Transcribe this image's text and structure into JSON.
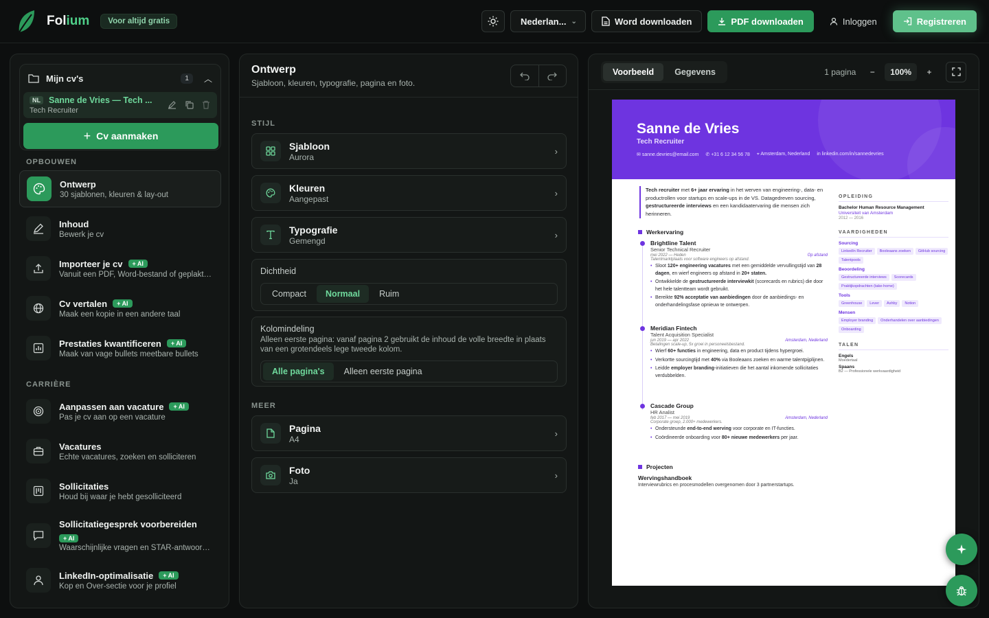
{
  "app": {
    "brand_first": "Fol",
    "brand_accent": "ium",
    "free_badge": "Voor altijd gratis"
  },
  "toolbar": {
    "language": "Nederlan...",
    "word_download": "Word downloaden",
    "pdf_download": "PDF downloaden",
    "login": "Inloggen",
    "register": "Registreren"
  },
  "cvs": {
    "title": "Mijn cv's",
    "count": "1",
    "item": {
      "lang": "NL",
      "name": "Sanne de Vries — Tech ...",
      "role": "Tech Recruiter"
    },
    "create": "Cv aanmaken"
  },
  "sidebar": {
    "section_build": "OPBOUWEN",
    "section_career": "CARRIÈRE",
    "ai_badge": "+ AI",
    "items": [
      {
        "title": "Ontwerp",
        "sub": "30 sjablonen, kleuren & lay-out"
      },
      {
        "title": "Inhoud",
        "sub": "Bewerk je cv"
      },
      {
        "title": "Importeer je cv",
        "sub": "Vanuit een PDF, Word-bestand of geplakte tekst"
      },
      {
        "title": "Cv vertalen",
        "sub": "Maak een kopie in een andere taal"
      },
      {
        "title": "Prestaties kwantificeren",
        "sub": "Maak van vage bullets meetbare bullets"
      },
      {
        "title": "Aanpassen aan vacature",
        "sub": "Pas je cv aan op een vacature"
      },
      {
        "title": "Vacatures",
        "sub": "Echte vacatures, zoeken en solliciteren"
      },
      {
        "title": "Sollicitaties",
        "sub": "Houd bij waar je hebt gesolliciteerd"
      },
      {
        "title": "Sollicitatiegesprek voorbereiden",
        "sub": "Waarschijnlijke vragen en STAR-antwoorden"
      },
      {
        "title": "LinkedIn-optimalisatie",
        "sub": "Kop en Over-sectie voor je profiel"
      }
    ]
  },
  "design": {
    "title": "Ontwerp",
    "subtitle": "Sjabloon, kleuren, typografie, pagina en foto.",
    "section_style": "STIJL",
    "section_more": "MEER",
    "options": [
      {
        "title": "Sjabloon",
        "value": "Aurora"
      },
      {
        "title": "Kleuren",
        "value": "Aangepast"
      },
      {
        "title": "Typografie",
        "value": "Gemengd"
      },
      {
        "title": "Pagina",
        "value": "A4"
      },
      {
        "title": "Foto",
        "value": "Ja"
      }
    ],
    "density": {
      "label": "Dichtheid",
      "options": [
        "Compact",
        "Normaal",
        "Ruim"
      ],
      "selected": "Normaal"
    },
    "columns": {
      "label": "Kolomindeling",
      "desc": "Alleen eerste pagina: vanaf pagina 2 gebruikt de inhoud de volle breedte in plaats van een grotendeels lege tweede kolom.",
      "options": [
        "Alle pagina's",
        "Alleen eerste pagina"
      ],
      "selected": "Alle pagina's"
    }
  },
  "preview": {
    "tabs": [
      "Voorbeeld",
      "Gegevens"
    ],
    "pages": "1 pagina",
    "zoom": "100%",
    "resume": {
      "name": "Sanne de Vries",
      "role": "Tech Recruiter",
      "email": "sanne.devries@email.com",
      "phone": "+31 6 12 34 56 78",
      "location": "Amsterdam, Nederland",
      "linkedin": "linkedin.com/in/sannedevries",
      "summary_html": "<b>Tech recruiter</b> met <b>6+ jaar ervaring</b> in het werven van engineering-, data- en productrollen voor startups en scale-ups in de VS. Datagedreven sourcing, <b>gestructureerde interviews</b> en een kandidaatervaring die mensen zich herinneren.",
      "experience_title": "Werkervaring",
      "jobs": [
        {
          "company": "Brightline Talent",
          "role": "Senior Technical Recruiter",
          "dates": "mei 2022 — Heden",
          "location": "Op afstand",
          "note": "Talentmarktplaats voor software engineers op afstand.",
          "bullets": [
            "Sloot <b>120+ engineering vacatures</b> met een gemiddelde vervullingstijd van <b>28 dagen</b>, en wierf engineers op afstand in <b>20+ staten.</b>",
            "Ontwikkelde de <b>gestructureerde interviewkit</b> (scorecards en rubrics) die door het hele talentteam wordt gebruikt.",
            "Bereikte <b>92% acceptatie van aanbiedingen</b> door de aanbiedings- en onderhandelingsfase opnieuw te ontwerpen."
          ]
        },
        {
          "company": "Meridian Fintech",
          "role": "Talent Acquisition Specialist",
          "dates": "jun 2019 — apr 2022",
          "location": "Amsterdam, Nederland",
          "note": "Betalingen scale-up, 5x groei in personeelsbestand.",
          "bullets": [
            "Wierf <b>60+ functies</b> in engineering, data en product tijdens hypergroei.",
            "Verkortte sourcingtijd met <b>40%</b> via Booleaans zoeken en warme talentpijplijnen.",
            "Leidde <b>employer branding</b>-initiatieven die het aantal inkomende sollicitaties verdubbelden."
          ]
        },
        {
          "company": "Cascade Group",
          "role": "HR Analist",
          "dates": "feb 2017 — mei 2019",
          "location": "Amsterdam, Nederland",
          "note": "Corporate groep, 2.000+ medewerkers.",
          "bullets": [
            "Ondersteunde <b>end-to-end werving</b> voor corporate en IT-functies.",
            "Coördineerde onboarding voor <b>80+ nieuwe medewerkers</b> per jaar."
          ]
        }
      ],
      "projects_title": "Projecten",
      "project": {
        "name": "Wervingshandboek",
        "desc": "Interviewrubrics en procesmodellen overgenomen door 3 partnerstartups."
      },
      "education_title": "OPLEIDING",
      "education": {
        "degree": "Bachelor Human Resource Management",
        "school": "Universiteit van Amsterdam",
        "years": "2012 — 2016"
      },
      "skills_title": "VAARDIGHEDEN",
      "skills": [
        {
          "group": "Sourcing",
          "tags": [
            "LinkedIn Recruiter",
            "Booleaans zoeken",
            "GitHub sourcing",
            "Talentpools"
          ]
        },
        {
          "group": "Beoordeling",
          "tags": [
            "Gestructureerde interviews",
            "Scorecards",
            "Praktijkopdrachten (take-home)"
          ]
        },
        {
          "group": "Tools",
          "tags": [
            "Greenhouse",
            "Lever",
            "Ashby",
            "Notion"
          ]
        },
        {
          "group": "Mensen",
          "tags": [
            "Employer branding",
            "Onderhandelen over aanbiedingen",
            "Onboarding"
          ]
        }
      ],
      "languages_title": "TALEN",
      "languages": [
        {
          "name": "Engels",
          "level": "Moedertaal"
        },
        {
          "name": "Spaans",
          "level": "B2 — Professionele werkvaardigheid"
        }
      ]
    }
  },
  "colors": {
    "accent": "#2c9a5b",
    "resume_accent": "#6e34e0",
    "bg": "#0d0f0f"
  }
}
